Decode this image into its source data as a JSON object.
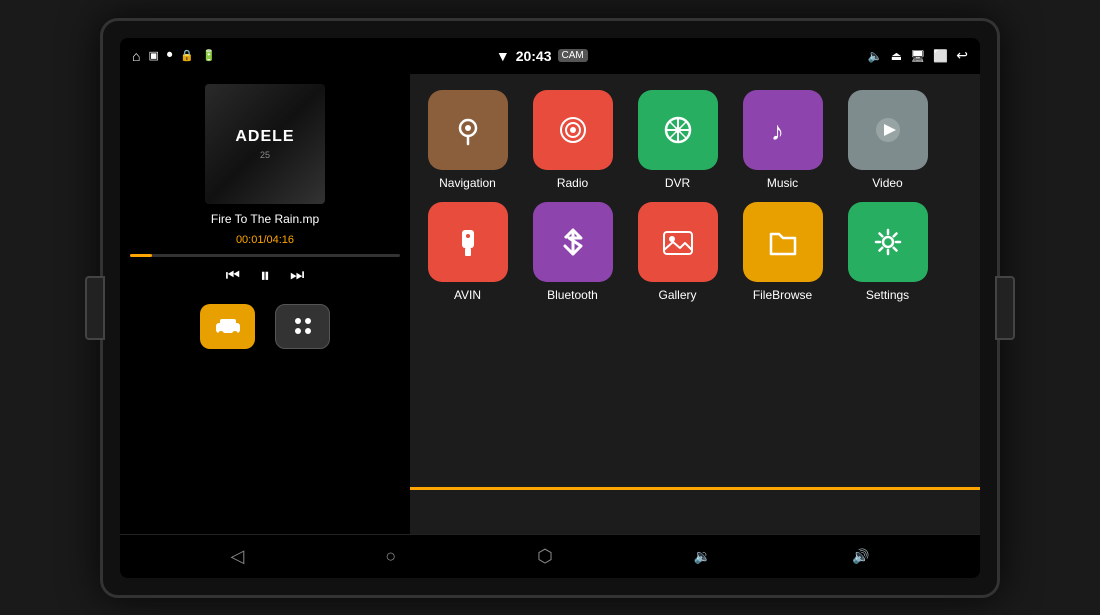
{
  "device": {
    "screen": {
      "status_bar": {
        "time": "20:43",
        "left_icons": [
          "home",
          "window",
          "record",
          "lock",
          "battery"
        ],
        "right_icons": [
          "wifi",
          "volume",
          "eject",
          "screen",
          "window2",
          "back"
        ],
        "camera_badge": "CAM"
      },
      "left_panel": {
        "album_title": "ADELE",
        "album_subtitle": "25",
        "track_name": "Fire To The Rain.mp",
        "track_time": "00:01/04:16",
        "progress_percent": 8,
        "controls": {
          "prev": "⏮",
          "play": "⏸",
          "next": "⏭"
        },
        "bottom_actions": {
          "menu_label": "☰",
          "grid_label": "⊞"
        }
      },
      "right_panel": {
        "apps_row1": [
          {
            "id": "navigation",
            "label": "Navigation",
            "color": "icon-nav",
            "icon": "nav"
          },
          {
            "id": "radio",
            "label": "Radio",
            "color": "icon-radio",
            "icon": "radio"
          },
          {
            "id": "dvr",
            "label": "DVR",
            "color": "icon-dvr",
            "icon": "dvr"
          },
          {
            "id": "music",
            "label": "Music",
            "color": "icon-music",
            "icon": "music"
          },
          {
            "id": "video",
            "label": "Video",
            "color": "icon-video",
            "icon": "video"
          }
        ],
        "apps_row2": [
          {
            "id": "avin",
            "label": "AVIN",
            "color": "icon-avin",
            "icon": "avin"
          },
          {
            "id": "bluetooth",
            "label": "Bluetooth",
            "color": "icon-bluetooth",
            "icon": "bluetooth"
          },
          {
            "id": "gallery",
            "label": "Gallery",
            "color": "icon-gallery",
            "icon": "gallery"
          },
          {
            "id": "filebrowse",
            "label": "FileBrowse",
            "color": "icon-filebrowse",
            "icon": "filebrowse"
          },
          {
            "id": "settings",
            "label": "Settings",
            "color": "icon-settings",
            "icon": "settings"
          }
        ]
      },
      "bottom_bar": {
        "items": [
          "⬛",
          "○",
          "⬡",
          "⬜",
          "↩"
        ]
      }
    }
  }
}
